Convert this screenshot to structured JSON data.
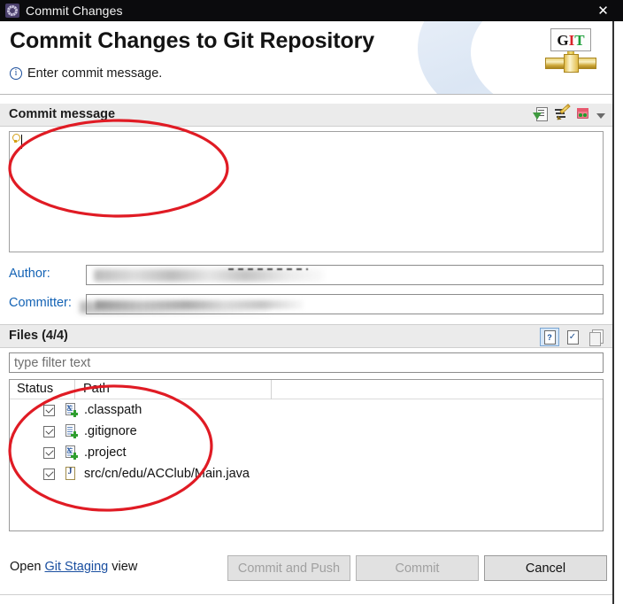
{
  "window": {
    "title": "Commit Changes",
    "icon": "eclipse-gear-icon",
    "close_label": "✕"
  },
  "header": {
    "title": "Commit Changes to Git Repository",
    "message": "Enter commit message.",
    "info_icon": "info-circle-icon",
    "logo": {
      "name": "git-logo",
      "g": "G",
      "i": "I",
      "t": "T"
    }
  },
  "commit_message": {
    "section_label": "Commit message",
    "value": "",
    "toolbar": [
      {
        "name": "add-signed-off-by-icon",
        "label": "Add Signed-off-by"
      },
      {
        "name": "amend-previous-commit-icon",
        "label": "Amend previous commit"
      },
      {
        "name": "add-change-id-icon",
        "label": "Add Change-Id"
      },
      {
        "name": "chevron-down-icon",
        "label": "More"
      }
    ]
  },
  "author": {
    "label": "Author:",
    "value": ""
  },
  "committer": {
    "label": "Committer:",
    "value": ""
  },
  "files": {
    "section_label": "Files (4/4)",
    "count_selected": 4,
    "count_total": 4,
    "toolbar": [
      {
        "name": "show-untracked-files-icon",
        "label": "Show untracked files",
        "selected": true
      },
      {
        "name": "select-all-icon",
        "label": "Select all",
        "selected": false
      },
      {
        "name": "deselect-all-icon",
        "label": "Deselect all",
        "selected": false
      }
    ],
    "filter": {
      "placeholder": "type filter text",
      "value": ""
    },
    "columns": [
      "Status",
      "Path"
    ],
    "rows": [
      {
        "checked": true,
        "icon": "xml-file-added-icon",
        "path": ".classpath"
      },
      {
        "checked": true,
        "icon": "text-file-added-icon",
        "path": ".gitignore"
      },
      {
        "checked": true,
        "icon": "xml-file-added-icon",
        "path": ".project"
      },
      {
        "checked": true,
        "icon": "java-file-icon",
        "path": "src/cn/edu/ACClub/Main.java"
      }
    ]
  },
  "footer": {
    "open_prefix": "Open ",
    "open_link": "Git Staging",
    "open_suffix": " view",
    "buttons": [
      {
        "name": "commit-and-push-button",
        "label": "Commit and Push",
        "enabled": false
      },
      {
        "name": "commit-button",
        "label": "Commit",
        "enabled": false
      },
      {
        "name": "cancel-button",
        "label": "Cancel",
        "enabled": true
      }
    ]
  },
  "annotations": {
    "color": "#e01b24",
    "shapes": [
      "ellipse-commit-message",
      "ellipse-file-list"
    ]
  }
}
